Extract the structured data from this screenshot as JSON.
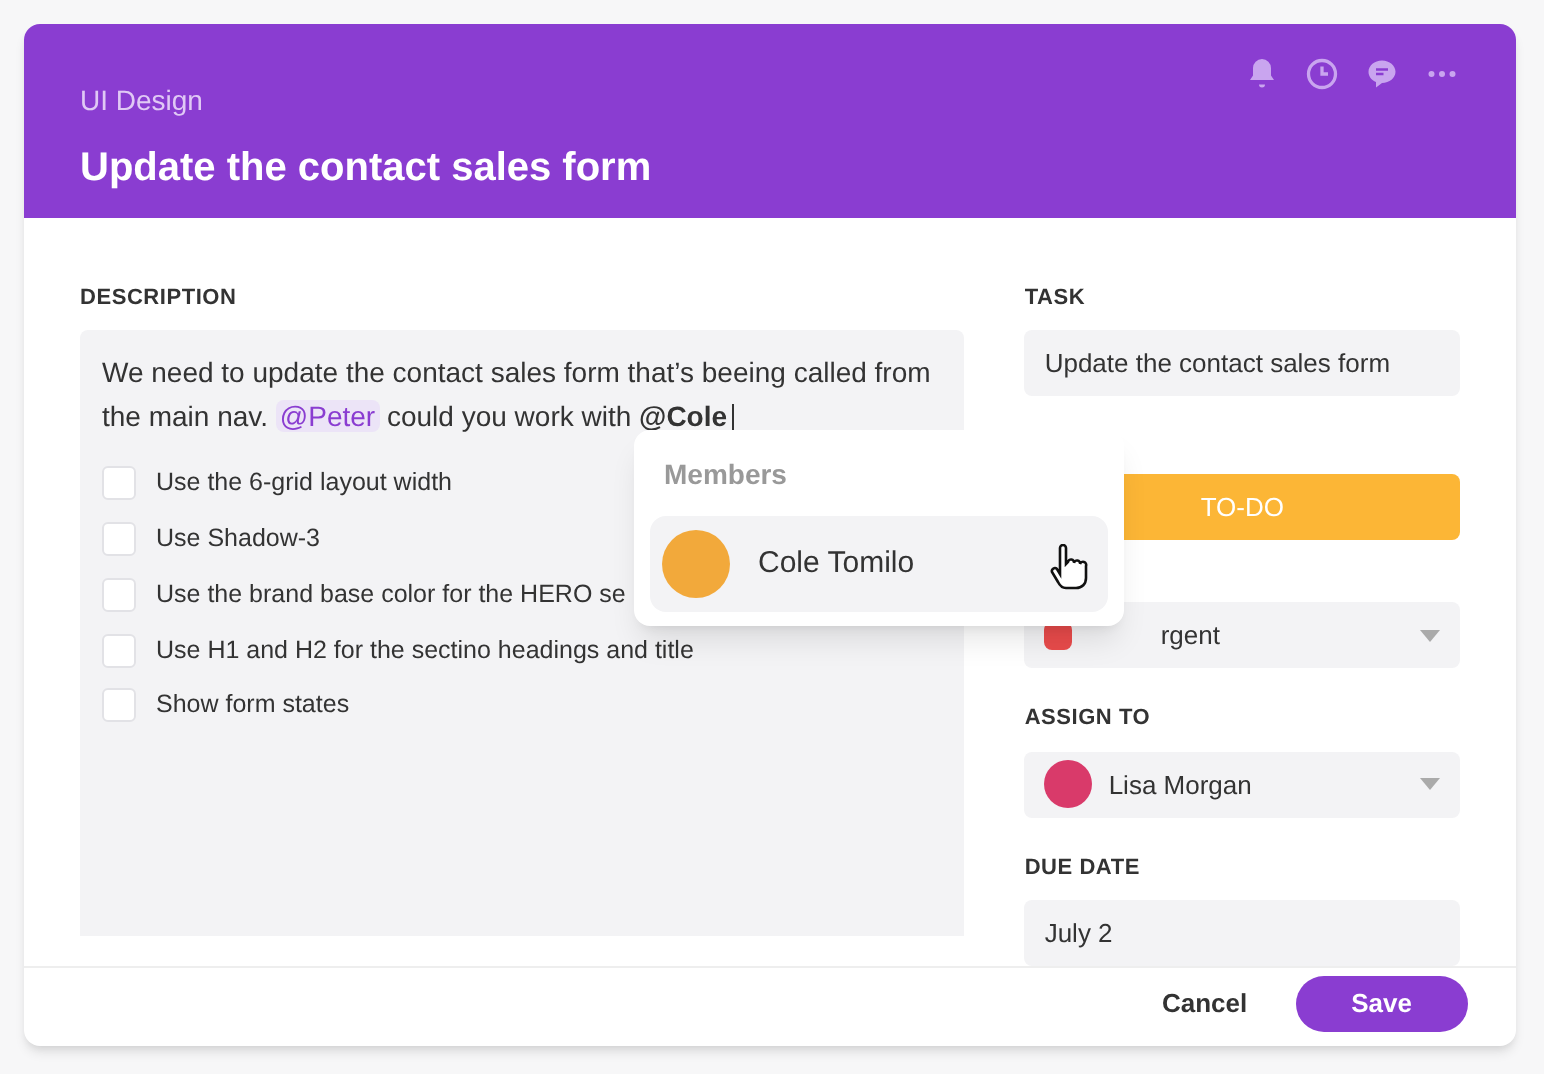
{
  "header": {
    "project": "UI Design",
    "title": "Update the contact sales form"
  },
  "description": {
    "label": "DESCRIPTION",
    "segments": [
      {
        "kind": "plain",
        "text": "We need to update the  contact sales form that’s beeing called from the main nav. "
      },
      {
        "kind": "mention",
        "text": "@Peter"
      },
      {
        "kind": "plain",
        "text": " could you work with "
      },
      {
        "kind": "bold",
        "text": "@Cole"
      }
    ],
    "checklist": [
      {
        "label": "Use the 6-grid layout width",
        "checked": false
      },
      {
        "label": "Use Shadow-3",
        "checked": false
      },
      {
        "label": "Use the brand base color for the HERO se",
        "checked": false
      },
      {
        "label": "Use H1 and H2 for the sectino headings and title",
        "checked": false
      },
      {
        "label": "Show form states",
        "checked": false
      }
    ]
  },
  "members_popup": {
    "title": "Members",
    "items": [
      {
        "name": "Cole Tomilo",
        "selected": true
      }
    ]
  },
  "task": {
    "label": "TASK",
    "value": "Update the contact sales form"
  },
  "status": {
    "value": "TO-DO"
  },
  "priority": {
    "value": "rgent"
  },
  "assign_to": {
    "label": "ASSIGN TO",
    "value": "Lisa Morgan"
  },
  "due_date": {
    "label": "DUE DATE",
    "value": "July 2"
  },
  "buttons": [
    {
      "kind": "secondary",
      "label": "Cancel"
    },
    {
      "kind": "primary",
      "label": "Save"
    }
  ]
}
